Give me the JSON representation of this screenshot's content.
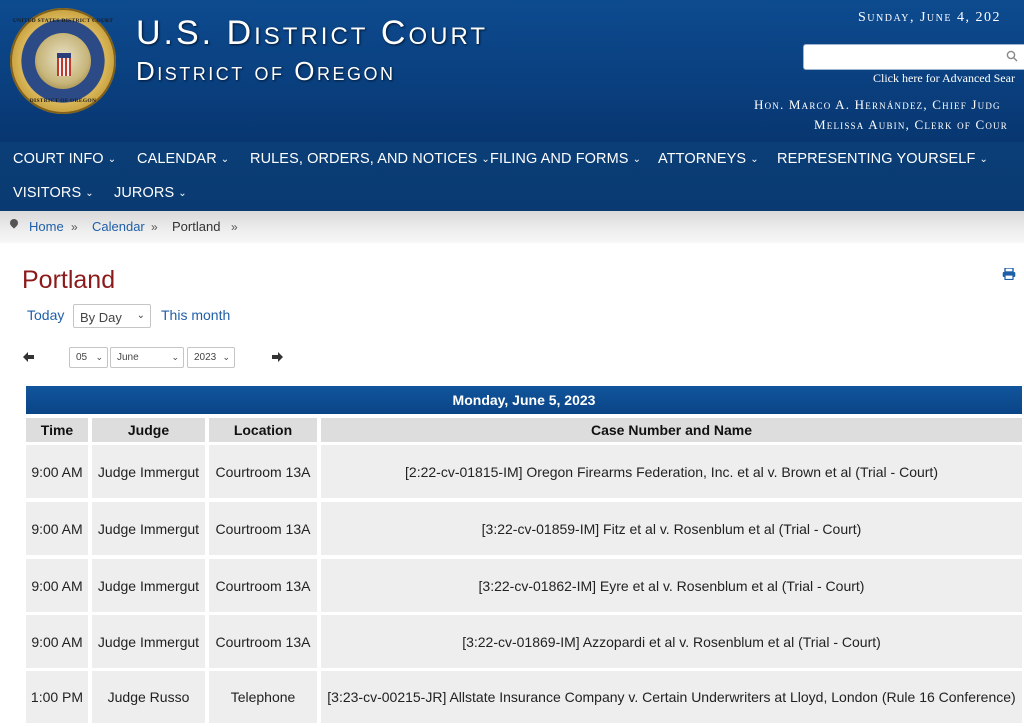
{
  "header": {
    "title_line1": "U.S. District Court",
    "title_line2": "District of Oregon",
    "date": "Sunday, June 4, 202",
    "search_placeholder": "",
    "advanced_search": "Click here for Advanced Sear",
    "chief_judge": "Hon. Marco A. Hernández, Chief Judg",
    "clerk": "Melissa Aubin, Clerk of Cour",
    "seal_text_top": "UNITED STATES DISTRICT COURT",
    "seal_text_bottom": "DISTRICT OF OREGON"
  },
  "nav": {
    "items": [
      {
        "label": "COURT INFO"
      },
      {
        "label": "CALENDAR"
      },
      {
        "label": "RULES, ORDERS, AND NOTICES"
      },
      {
        "label": "FILING AND FORMS"
      },
      {
        "label": "ATTORNEYS"
      },
      {
        "label": "REPRESENTING YOURSELF"
      },
      {
        "label": "VISITORS"
      },
      {
        "label": "JURORS"
      }
    ],
    "chevron": "⌄"
  },
  "breadcrumb": {
    "items": [
      "Home",
      "Calendar",
      "Portland"
    ],
    "separator": "»"
  },
  "page": {
    "title": "Portland",
    "today": "Today",
    "view_select": "By Day",
    "this_month": "This month"
  },
  "date_picker": {
    "day": "05",
    "month": "June",
    "year": "2023",
    "prev_icon": "arrow-left",
    "next_icon": "arrow-right"
  },
  "calendar": {
    "day_heading": "Monday, June 5, 2023",
    "columns": [
      "Time",
      "Judge",
      "Location",
      "Case Number and Name"
    ],
    "rows": [
      {
        "time": "9:00 AM",
        "judge": "Judge Immergut",
        "location": "Courtroom 13A",
        "case": "[2:22-cv-01815-IM] Oregon Firearms Federation, Inc. et al v. Brown et al (Trial - Court)"
      },
      {
        "time": "9:00 AM",
        "judge": "Judge Immergut",
        "location": "Courtroom 13A",
        "case": "[3:22-cv-01859-IM] Fitz et al v. Rosenblum et al (Trial - Court)"
      },
      {
        "time": "9:00 AM",
        "judge": "Judge Immergut",
        "location": "Courtroom 13A",
        "case": "[3:22-cv-01862-IM] Eyre et al v. Rosenblum et al (Trial - Court)"
      },
      {
        "time": "9:00 AM",
        "judge": "Judge Immergut",
        "location": "Courtroom 13A",
        "case": "[3:22-cv-01869-IM] Azzopardi et al v. Rosenblum et al (Trial - Court)"
      },
      {
        "time": "1:00 PM",
        "judge": "Judge Russo",
        "location": "Telephone",
        "case": "[3:23-cv-00215-JR] Allstate Insurance Company v. Certain Underwriters at Lloyd, London (Rule 16 Conference)"
      }
    ]
  },
  "colors": {
    "header_blue": "#0a3f7e",
    "title_red": "#8b1a1a",
    "link_blue": "#1f5fa8",
    "row_gray": "#eeeeee",
    "column_gray": "#dddddd"
  }
}
